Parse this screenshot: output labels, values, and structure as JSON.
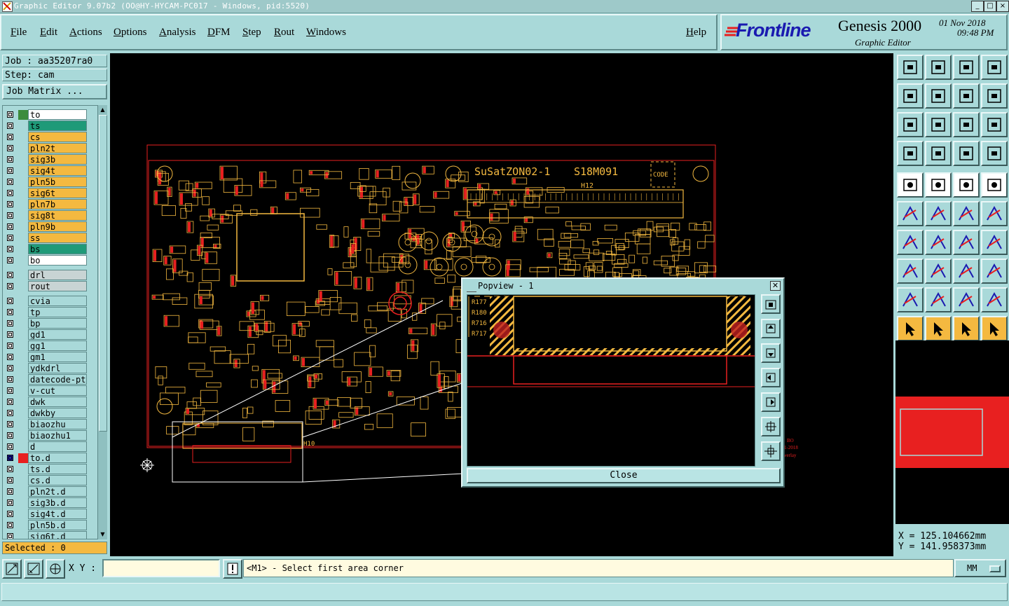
{
  "window": {
    "title": "Graphic Editor 9.07b2 (OO@HY-HYCAM-PC017 - Windows, pid:5520)",
    "controls": [
      "_",
      "□",
      "×"
    ]
  },
  "menu": {
    "items": [
      "File",
      "Edit",
      "Actions",
      "Options",
      "Analysis",
      "DFM",
      "Step",
      "Rout",
      "Windows"
    ],
    "help": "Help"
  },
  "header": {
    "brand": "Frontline",
    "product": "Genesis 2000",
    "subtitle": "Graphic Editor",
    "date": "01 Nov 2018",
    "time": "09:48 PM"
  },
  "left_panel": {
    "job": "Job : aa35207ra0",
    "step": "Step: cam",
    "job_matrix": "Job Matrix ...",
    "layers": [
      {
        "name": "to",
        "color": "#ffffff",
        "marker": "#3c8c3c"
      },
      {
        "name": "ts",
        "color": "#1f9a78",
        "marker": ""
      },
      {
        "name": "cs",
        "color": "#f4b940",
        "marker": ""
      },
      {
        "name": "pln2t",
        "color": "#f4b940",
        "marker": ""
      },
      {
        "name": "sig3b",
        "color": "#f4b940",
        "marker": ""
      },
      {
        "name": "sig4t",
        "color": "#f4b940",
        "marker": ""
      },
      {
        "name": "pln5b",
        "color": "#f4b940",
        "marker": ""
      },
      {
        "name": "sig6t",
        "color": "#f4b940",
        "marker": ""
      },
      {
        "name": "pln7b",
        "color": "#f4b940",
        "marker": ""
      },
      {
        "name": "sig8t",
        "color": "#f4b940",
        "marker": ""
      },
      {
        "name": "pln9b",
        "color": "#f4b940",
        "marker": ""
      },
      {
        "name": "ss",
        "color": "#f4b940",
        "marker": ""
      },
      {
        "name": "bs",
        "color": "#1f9a78",
        "marker": ""
      },
      {
        "name": "bo",
        "color": "#ffffff",
        "marker": ""
      },
      {
        "name": "drl",
        "color": "#c8d4d4",
        "marker": "",
        "gap": true
      },
      {
        "name": "rout",
        "color": "#c8d4d4",
        "marker": ""
      },
      {
        "name": "cvia",
        "color": "#a9d9d9",
        "marker": "",
        "gap": true
      },
      {
        "name": "tp",
        "color": "#a9d9d9",
        "marker": ""
      },
      {
        "name": "bp",
        "color": "#a9d9d9",
        "marker": ""
      },
      {
        "name": "gd1",
        "color": "#a9d9d9",
        "marker": ""
      },
      {
        "name": "gg1",
        "color": "#a9d9d9",
        "marker": ""
      },
      {
        "name": "gm1",
        "color": "#a9d9d9",
        "marker": ""
      },
      {
        "name": "ydkdrl",
        "color": "#a9d9d9",
        "marker": ""
      },
      {
        "name": "datecode-ptc",
        "color": "#a9d9d9",
        "marker": ""
      },
      {
        "name": "v-cut",
        "color": "#a9d9d9",
        "marker": ""
      },
      {
        "name": "dwk",
        "color": "#a9d9d9",
        "marker": ""
      },
      {
        "name": "dwkby",
        "color": "#a9d9d9",
        "marker": ""
      },
      {
        "name": "biaozhu",
        "color": "#a9d9d9",
        "marker": ""
      },
      {
        "name": "biaozhu1",
        "color": "#a9d9d9",
        "marker": ""
      },
      {
        "name": "d",
        "color": "#a9d9d9",
        "marker": ""
      },
      {
        "name": "to.d",
        "color": "#a9d9d9",
        "marker": "#e82020",
        "cb": "#1a1ab0"
      },
      {
        "name": "ts.d",
        "color": "#a9d9d9",
        "marker": ""
      },
      {
        "name": "cs.d",
        "color": "#a9d9d9",
        "marker": ""
      },
      {
        "name": "pln2t.d",
        "color": "#a9d9d9",
        "marker": ""
      },
      {
        "name": "sig3b.d",
        "color": "#a9d9d9",
        "marker": ""
      },
      {
        "name": "sig4t.d",
        "color": "#a9d9d9",
        "marker": ""
      },
      {
        "name": "pln5b.d",
        "color": "#a9d9d9",
        "marker": ""
      },
      {
        "name": "sig6t.d",
        "color": "#a9d9d9",
        "marker": ""
      }
    ],
    "selected": "Selected : 0"
  },
  "board": {
    "silk_title": "SuSatZON02-1",
    "silk_code": "S18M091",
    "code_box": "CODE",
    "hole_label": "H12",
    "h10": "H10",
    "side_labels": [
      "BO",
      "1-2018",
      "verlay"
    ]
  },
  "popview": {
    "title": "Popview - 1",
    "refs": [
      "R177",
      "R180",
      "R716",
      "R717"
    ],
    "close": "Close"
  },
  "coords": {
    "x": "X = 125.104662mm",
    "y": "Y = 141.958373mm"
  },
  "bottom": {
    "xy_label": "X Y :",
    "xy_value": "",
    "prompt": "<M1> - Select first area corner",
    "units": "MM"
  },
  "colors": {
    "panel": "#a9d9d9",
    "board_outline": "#e82020",
    "silk": "#f4b940",
    "canvas": "#000000"
  }
}
